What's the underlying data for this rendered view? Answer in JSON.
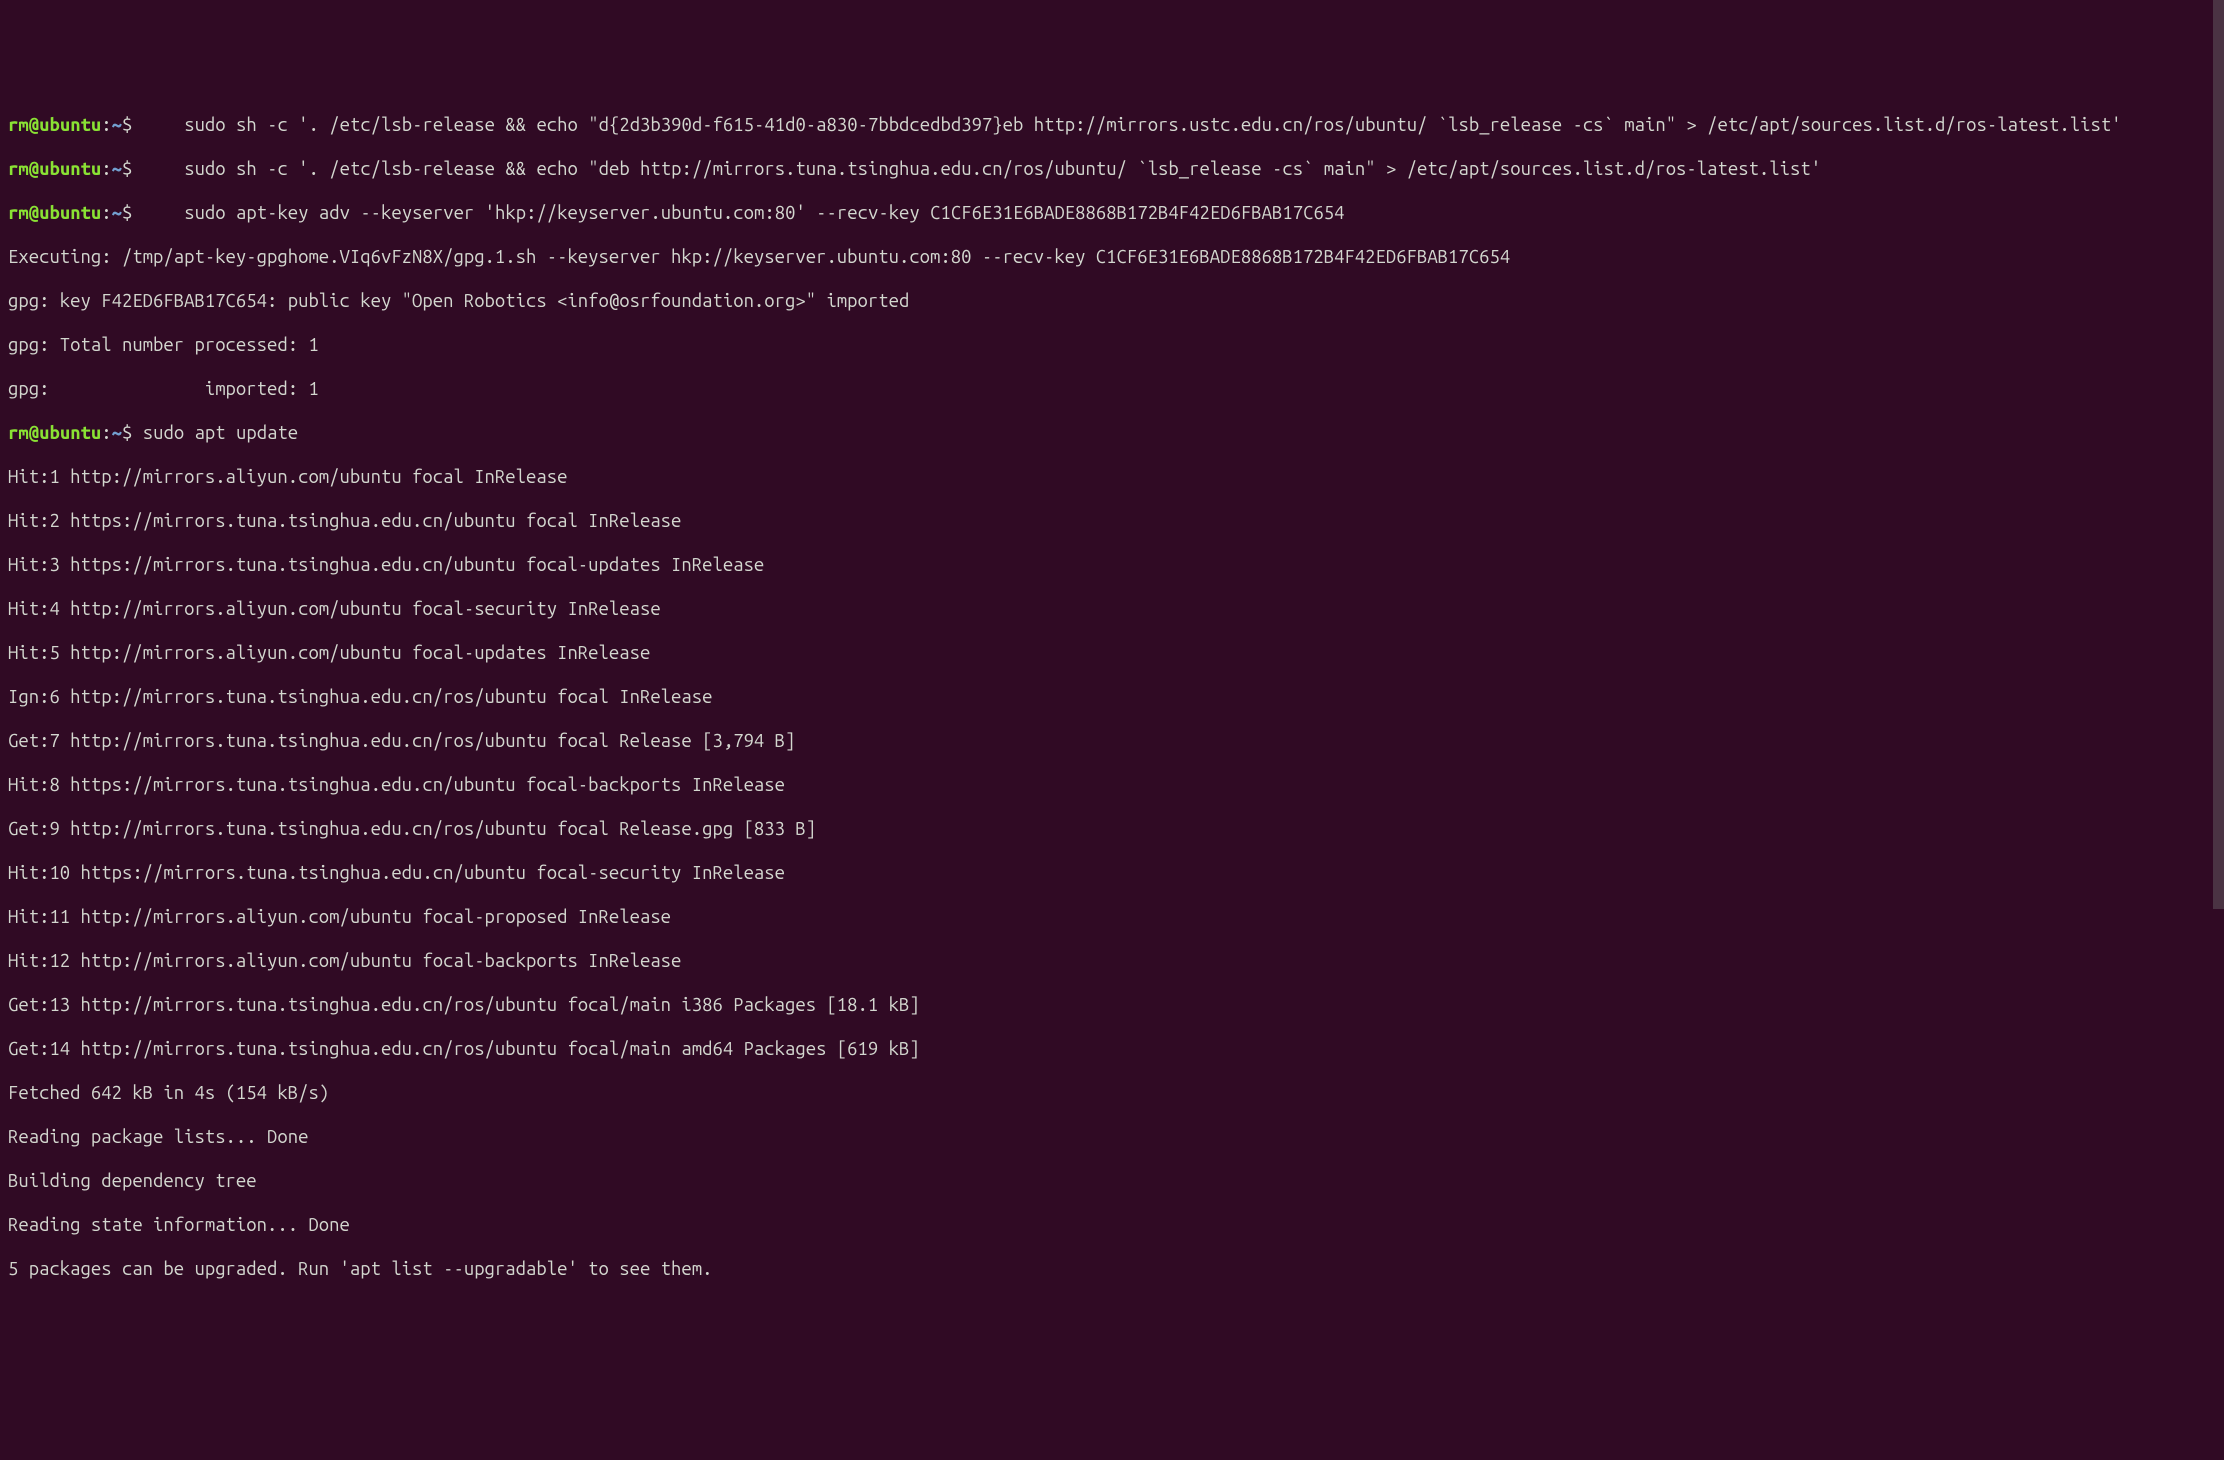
{
  "prompt": {
    "user": "rm",
    "at": "@",
    "host": "ubuntu",
    "colon": ":",
    "path": "~",
    "dollar": "$"
  },
  "lines": {
    "cmd1": "     sudo sh -c '. /etc/lsb-release && echo \"d{2d3b390d-f615-41d0-a830-7bbdcedbd397}eb http://mirrors.ustc.edu.cn/ros/ubuntu/ `lsb_release -cs` main\" > /etc/apt/sources.list.d/ros-latest.list'",
    "cmd2": "     sudo sh -c '. /etc/lsb-release && echo \"deb http://mirrors.tuna.tsinghua.edu.cn/ros/ubuntu/ `lsb_release -cs` main\" > /etc/apt/sources.list.d/ros-latest.list'",
    "cmd3": "     sudo apt-key adv --keyserver 'hkp://keyserver.ubuntu.com:80' --recv-key C1CF6E31E6BADE8868B172B4F42ED6FBAB17C654",
    "out1": "Executing: /tmp/apt-key-gpghome.VIq6vFzN8X/gpg.1.sh --keyserver hkp://keyserver.ubuntu.com:80 --recv-key C1CF6E31E6BADE8868B172B4F42ED6FBAB17C654",
    "out2": "gpg: key F42ED6FBAB17C654: public key \"Open Robotics <info@osrfoundation.org>\" imported",
    "out3": "gpg: Total number processed: 1",
    "out4": "gpg:               imported: 1",
    "cmd4": " sudo apt update",
    "hit1": "Hit:1 http://mirrors.aliyun.com/ubuntu focal InRelease",
    "hit2": "Hit:2 https://mirrors.tuna.tsinghua.edu.cn/ubuntu focal InRelease",
    "hit3": "Hit:3 https://mirrors.tuna.tsinghua.edu.cn/ubuntu focal-updates InRelease",
    "hit4": "Hit:4 http://mirrors.aliyun.com/ubuntu focal-security InRelease",
    "hit5": "Hit:5 http://mirrors.aliyun.com/ubuntu focal-updates InRelease",
    "ign6": "Ign:6 http://mirrors.tuna.tsinghua.edu.cn/ros/ubuntu focal InRelease",
    "get7": "Get:7 http://mirrors.tuna.tsinghua.edu.cn/ros/ubuntu focal Release [3,794 B]",
    "hit8": "Hit:8 https://mirrors.tuna.tsinghua.edu.cn/ubuntu focal-backports InRelease",
    "get9": "Get:9 http://mirrors.tuna.tsinghua.edu.cn/ros/ubuntu focal Release.gpg [833 B]",
    "hit10": "Hit:10 https://mirrors.tuna.tsinghua.edu.cn/ubuntu focal-security InRelease",
    "hit11": "Hit:11 http://mirrors.aliyun.com/ubuntu focal-proposed InRelease",
    "hit12": "Hit:12 http://mirrors.aliyun.com/ubuntu focal-backports InRelease",
    "get13": "Get:13 http://mirrors.tuna.tsinghua.edu.cn/ros/ubuntu focal/main i386 Packages [18.1 kB]",
    "get14": "Get:14 http://mirrors.tuna.tsinghua.edu.cn/ros/ubuntu focal/main amd64 Packages [619 kB]",
    "fetched": "Fetched 642 kB in 4s (154 kB/s)",
    "reading1": "Reading package lists... Done",
    "building": "Building dependency tree",
    "reading2": "Reading state information... Done",
    "upgradable": "5 packages can be upgraded. Run 'apt list --upgradable' to see them."
  }
}
